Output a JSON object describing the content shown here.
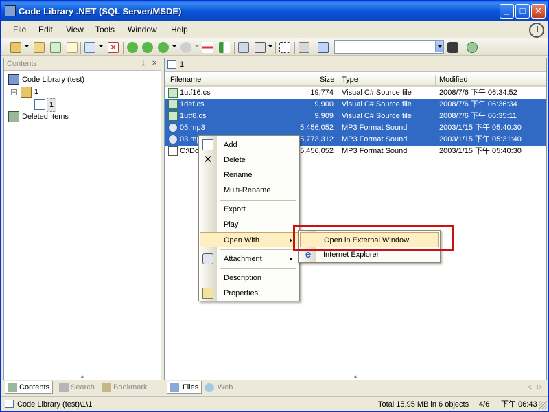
{
  "window": {
    "title": "Code Library .NET (SQL Server/MSDE)"
  },
  "menubar": [
    "File",
    "Edit",
    "View",
    "Tools",
    "Window",
    "Help"
  ],
  "toolbar": {
    "search_value": ""
  },
  "left_pane": {
    "title": "Contents",
    "tree": [
      {
        "label": "Code Library (test)"
      },
      {
        "label": "1"
      },
      {
        "label": "1"
      },
      {
        "label": "Deleted Items"
      }
    ],
    "tabs": [
      "Contents",
      "Search",
      "Bookmark"
    ]
  },
  "right_pane": {
    "address": "1",
    "columns": [
      "Filename",
      "Size",
      "Type",
      "Modified"
    ],
    "rows": [
      {
        "name": "1utf16.cs",
        "size": "19,774",
        "type": "Visual C# Source file",
        "modified": "2008/7/6 下午 06:34:52",
        "selected": false
      },
      {
        "name": "1def.cs",
        "size": "9,900",
        "type": "Visual C# Source file",
        "modified": "2008/7/6 下午 06:36:34",
        "selected": true
      },
      {
        "name": "1utf8.cs",
        "size": "9,909",
        "type": "Visual C# Source file",
        "modified": "2008/7/6 下午 06:35:11",
        "selected": true
      },
      {
        "name": "05.mp3",
        "size": "5,456,052",
        "type": "MP3 Format Sound",
        "modified": "2003/1/15 下午 05:40:30",
        "selected": true
      },
      {
        "name": "03.mp",
        "size": "5,773,312",
        "type": "MP3 Format Sound",
        "modified": "2003/1/15 下午 05:31:40",
        "selected": true
      },
      {
        "name": "C:\\Do",
        "size": "5,456,052",
        "type": "MP3 Format Sound",
        "modified": "2003/1/15 下午 05:40:30",
        "selected": false
      }
    ],
    "tabs": [
      "Files",
      "Web"
    ]
  },
  "context_menu": {
    "items": [
      "Add",
      "Delete",
      "Rename",
      "Multi-Rename",
      "Export",
      "Play",
      "Open With",
      "Attachment",
      "Description",
      "Properties"
    ]
  },
  "submenu": {
    "items": [
      "Open in External Window",
      "Internet Explorer"
    ]
  },
  "statusbar": {
    "path": "Code Library (test)\\1\\1",
    "total": "Total 15.95 MB in 6 objects",
    "position": "4/6",
    "time": "下午 06:43"
  },
  "colors": {
    "selection": "#316ac5",
    "highlight_box": "#cc1111",
    "menu_hover": "#ffeec2"
  }
}
